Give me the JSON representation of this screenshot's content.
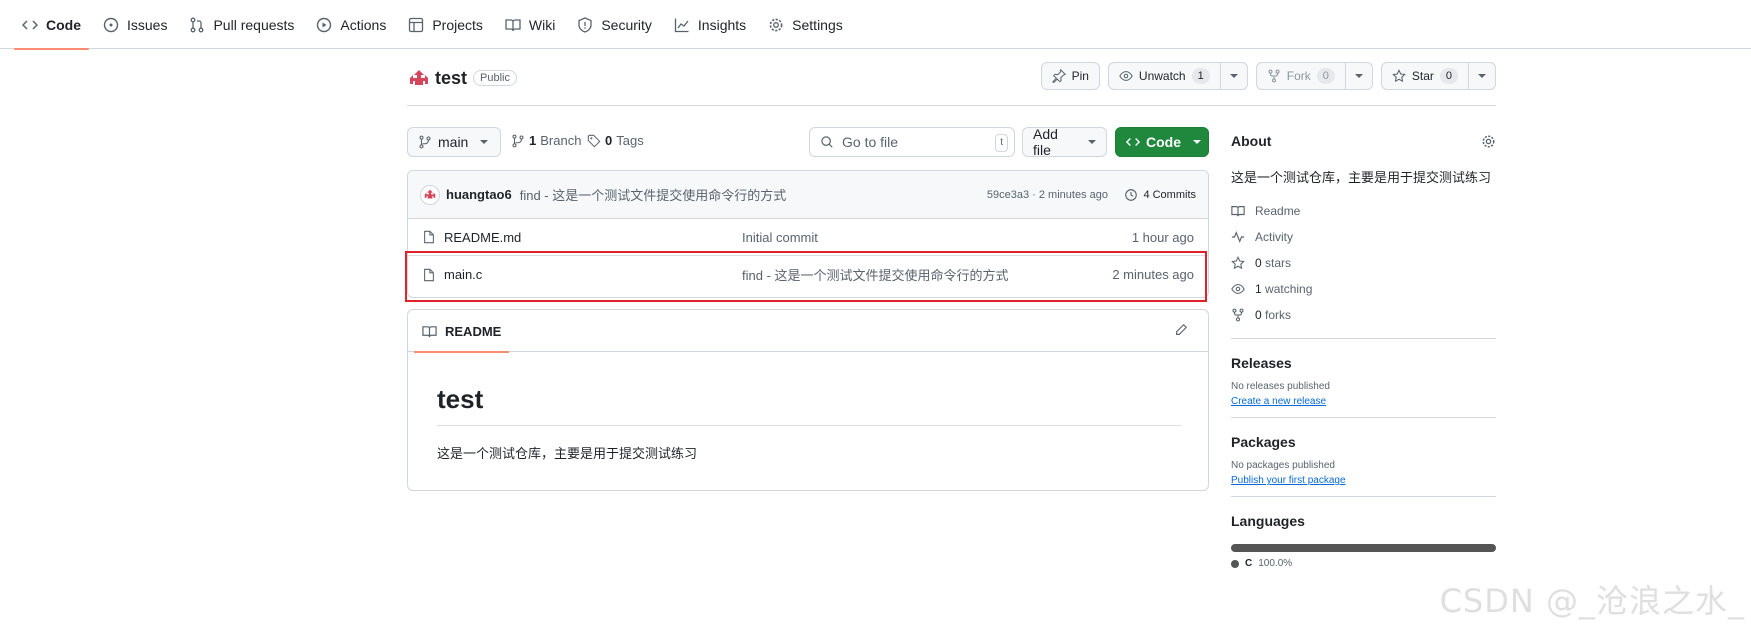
{
  "nav": {
    "tabs": [
      {
        "label": "Code",
        "icon": "code-icon"
      },
      {
        "label": "Issues",
        "icon": "issue-icon"
      },
      {
        "label": "Pull requests",
        "icon": "pull-request-icon"
      },
      {
        "label": "Actions",
        "icon": "play-icon"
      },
      {
        "label": "Projects",
        "icon": "table-icon"
      },
      {
        "label": "Wiki",
        "icon": "book-icon"
      },
      {
        "label": "Security",
        "icon": "shield-icon"
      },
      {
        "label": "Insights",
        "icon": "graph-icon"
      },
      {
        "label": "Settings",
        "icon": "gear-icon"
      }
    ],
    "active_tab": "Code"
  },
  "repo": {
    "name": "test",
    "visibility": "Public",
    "pin_label": "Pin",
    "unwatch_label": "Unwatch",
    "watch_count": "1",
    "fork_label": "Fork",
    "fork_count": "0",
    "star_label": "Star",
    "star_count": "0"
  },
  "bar": {
    "branch": "main",
    "branch_count": "1",
    "branch_label": "Branch",
    "tag_count": "0",
    "tag_label": "Tags",
    "search_placeholder": "Go to file",
    "search_key": "t",
    "add_file_label": "Add file",
    "code_label": "Code"
  },
  "commit": {
    "author": "huangtao6",
    "message": "find - 这是一个测试文件提交使用命令行的方式",
    "meta": "59ce3a3 · 2 minutes ago",
    "commits_label": "4 Commits"
  },
  "files": [
    {
      "name": "README.md",
      "message": "Initial commit",
      "time": "1 hour ago"
    },
    {
      "name": "main.c",
      "message": "find - 这是一个测试文件提交使用命令行的方式",
      "time": "2 minutes ago"
    }
  ],
  "readme": {
    "tab_label": "README",
    "heading": "test",
    "body": "这是一个测试仓库，主要是用于提交测试练习"
  },
  "about": {
    "title": "About",
    "description": "这是一个测试仓库，主要是用于提交测试练习",
    "readme": "Readme",
    "activity": "Activity",
    "stars_count": "0",
    "stars_label": "stars",
    "watching_count": "1",
    "watching_label": "watching",
    "forks_count": "0",
    "forks_label": "forks"
  },
  "releases": {
    "title": "Releases",
    "none": "No releases published",
    "link": "Create a new release"
  },
  "packages": {
    "title": "Packages",
    "none": "No packages published",
    "link": "Publish your first package"
  },
  "languages": {
    "title": "Languages",
    "items": [
      {
        "name": "C",
        "percent": "100.0%",
        "color": "#555555"
      }
    ]
  },
  "watermark": "CSDN @_沧浪之水_",
  "colors": {
    "accent_tab": "#fd8c73",
    "code_button": "#1f883d",
    "highlight": "#e0232a",
    "link": "#0969da"
  }
}
